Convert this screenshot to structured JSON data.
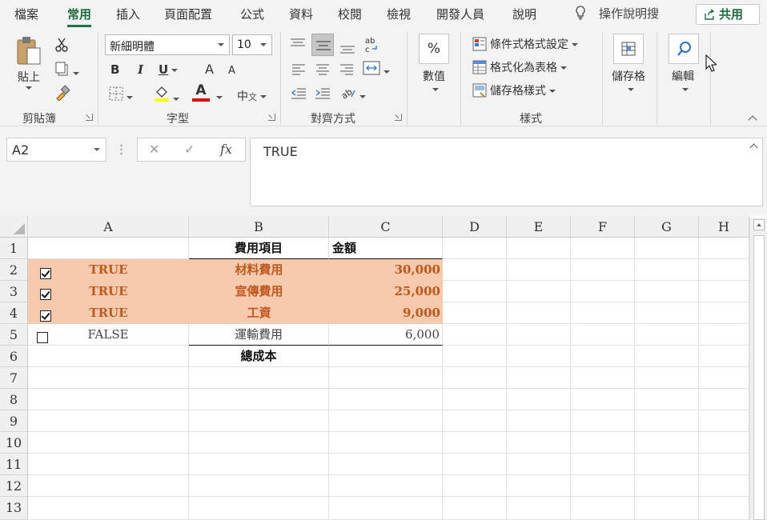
{
  "menu": {
    "tabs": [
      "檔案",
      "常用",
      "插入",
      "頁面配置",
      "公式",
      "資料",
      "校閱",
      "檢視",
      "開發人員",
      "說明"
    ],
    "tell_me": "操作說明搜",
    "share": "共用"
  },
  "ribbon": {
    "clipboard": {
      "paste": "貼上",
      "label": "剪貼簿"
    },
    "font": {
      "name": "新細明體",
      "size": "10",
      "bold": "B",
      "italic": "I",
      "underline": "U",
      "grow": "A",
      "shrink": "A",
      "font_color": "A",
      "phonetic": "中",
      "label": "字型",
      "fill_color": "#ffff00",
      "font_color_hex": "#e00000"
    },
    "alignment": {
      "label": "對齊方式"
    },
    "number": {
      "symbol": "%",
      "button": "數值"
    },
    "styles": {
      "conditional": "條件式格式設定",
      "format_table": "格式化為表格",
      "cell_styles": "儲存格樣式",
      "label": "樣式"
    },
    "cells": {
      "button": "儲存格"
    },
    "editing": {
      "button": "編輯"
    }
  },
  "formula_bar": {
    "name_box": "A2",
    "cancel": "✕",
    "enter": "✓",
    "fx": "fx",
    "content": "TRUE"
  },
  "sheet": {
    "columns": [
      "A",
      "B",
      "C",
      "D",
      "E",
      "F",
      "G",
      "H"
    ],
    "rows": [
      "1",
      "2",
      "3",
      "4",
      "5",
      "6",
      "7",
      "8",
      "9",
      "10",
      "11",
      "12",
      "13"
    ],
    "header": {
      "item": "費用項目",
      "amount": "金額"
    },
    "data": [
      {
        "checked": true,
        "flag": "TRUE",
        "item": "材料費用",
        "amount": "30,000"
      },
      {
        "checked": true,
        "flag": "TRUE",
        "item": "宣傳費用",
        "amount": "25,000"
      },
      {
        "checked": true,
        "flag": "TRUE",
        "item": "工資",
        "amount": "9,000"
      },
      {
        "checked": false,
        "flag": "FALSE",
        "item": "運輸費用",
        "amount": "6,000"
      }
    ],
    "total_label": "總成本",
    "highlight_color": "#f7c9ad"
  }
}
